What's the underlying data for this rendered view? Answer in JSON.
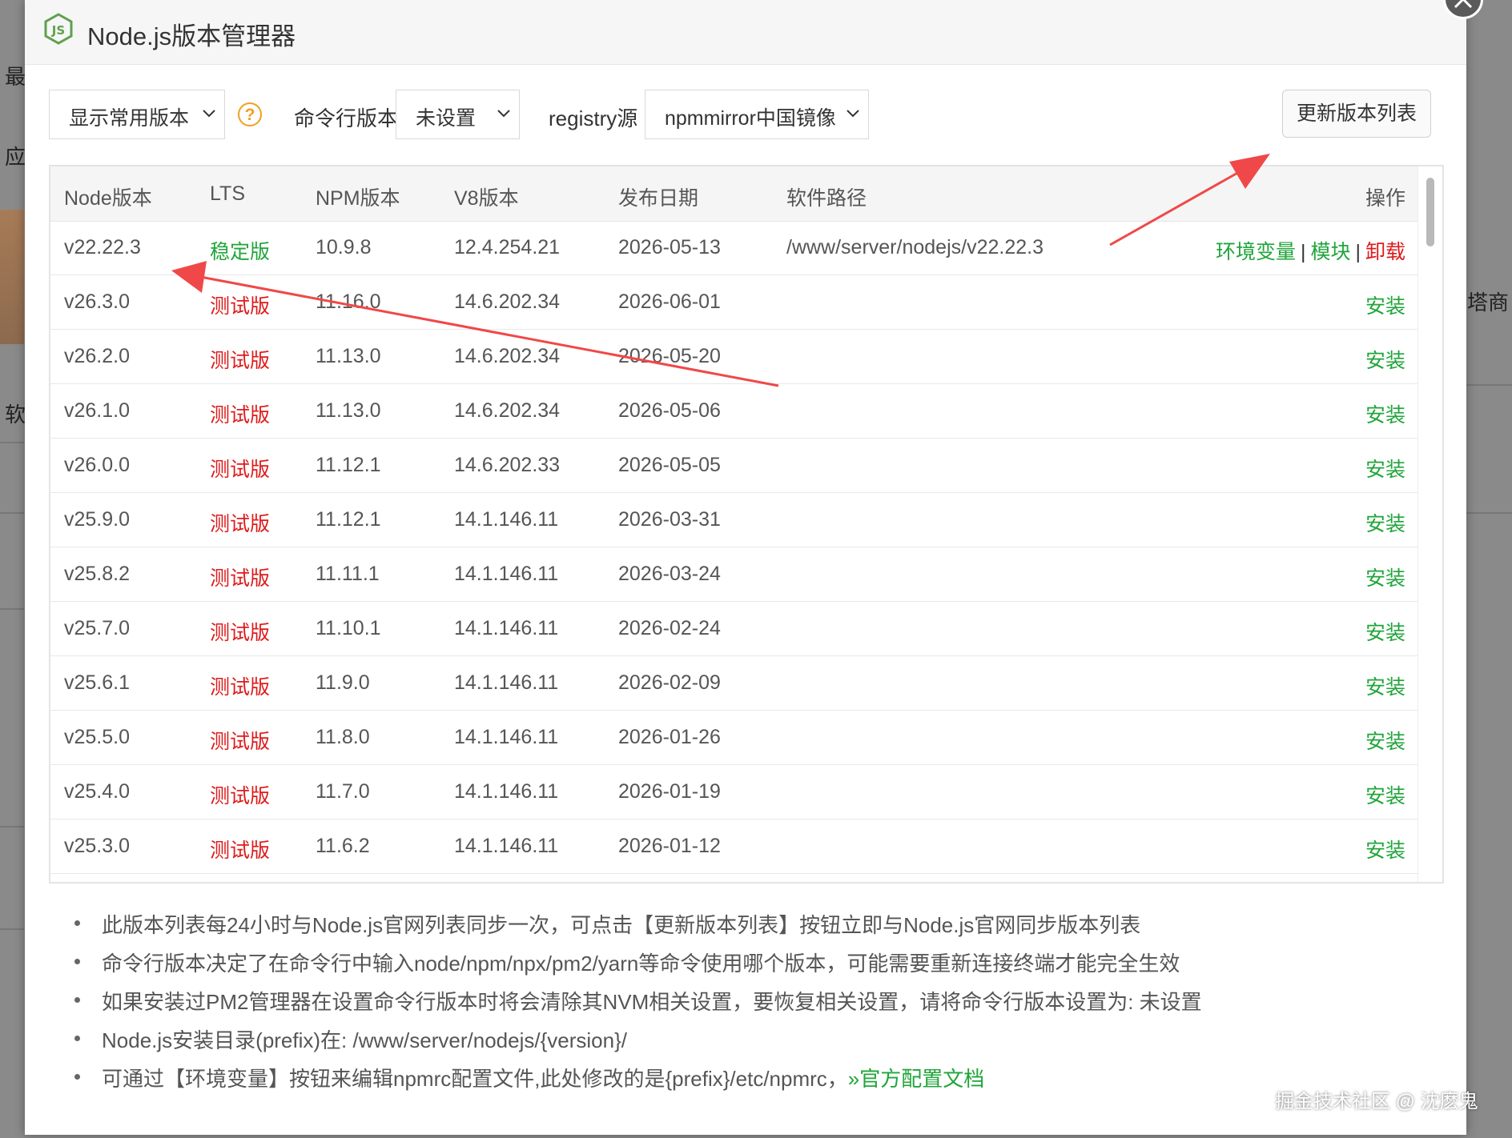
{
  "background": {
    "left_chars": [
      "最",
      "应",
      "软"
    ],
    "right_text": "塔商"
  },
  "dialog": {
    "title": "Node.js版本管理器",
    "logo_icon": "nodejs-icon",
    "close_icon": "close-icon"
  },
  "toolbar": {
    "version_filter": "显示常用版本",
    "help_icon": "?",
    "cli_label": "命令行版本",
    "cli_value": "未设置",
    "registry_label": "registry源",
    "registry_value": "npmmirror中国镜像",
    "update_button": "更新版本列表"
  },
  "table": {
    "headers": {
      "node": "Node版本",
      "lts": "LTS",
      "npm": "NPM版本",
      "v8": "V8版本",
      "date": "发布日期",
      "path": "软件路径",
      "action": "操作"
    },
    "rows": [
      {
        "node": "v22.22.3",
        "lts": "稳定版",
        "npm": "10.9.8",
        "v8": "12.4.254.21",
        "date": "2026-05-13",
        "path": "/www/server/nodejs/v22.22.3",
        "env": "环境变量",
        "modules": "模块",
        "uninstall": "卸载",
        "sep": "|"
      },
      {
        "node": "v26.3.0",
        "lts": "测试版",
        "npm": "11.16.0",
        "v8": "14.6.202.34",
        "date": "2026-06-01",
        "install": "安装"
      },
      {
        "node": "v26.2.0",
        "lts": "测试版",
        "npm": "11.13.0",
        "v8": "14.6.202.34",
        "date": "2026-05-20",
        "install": "安装"
      },
      {
        "node": "v26.1.0",
        "lts": "测试版",
        "npm": "11.13.0",
        "v8": "14.6.202.34",
        "date": "2026-05-06",
        "install": "安装"
      },
      {
        "node": "v26.0.0",
        "lts": "测试版",
        "npm": "11.12.1",
        "v8": "14.6.202.33",
        "date": "2026-05-05",
        "install": "安装"
      },
      {
        "node": "v25.9.0",
        "lts": "测试版",
        "npm": "11.12.1",
        "v8": "14.1.146.11",
        "date": "2026-03-31",
        "install": "安装"
      },
      {
        "node": "v25.8.2",
        "lts": "测试版",
        "npm": "11.11.1",
        "v8": "14.1.146.11",
        "date": "2026-03-24",
        "install": "安装"
      },
      {
        "node": "v25.7.0",
        "lts": "测试版",
        "npm": "11.10.1",
        "v8": "14.1.146.11",
        "date": "2026-02-24",
        "install": "安装"
      },
      {
        "node": "v25.6.1",
        "lts": "测试版",
        "npm": "11.9.0",
        "v8": "14.1.146.11",
        "date": "2026-02-09",
        "install": "安装"
      },
      {
        "node": "v25.5.0",
        "lts": "测试版",
        "npm": "11.8.0",
        "v8": "14.1.146.11",
        "date": "2026-01-26",
        "install": "安装"
      },
      {
        "node": "v25.4.0",
        "lts": "测试版",
        "npm": "11.7.0",
        "v8": "14.1.146.11",
        "date": "2026-01-19",
        "install": "安装"
      },
      {
        "node": "v25.3.0",
        "lts": "测试版",
        "npm": "11.6.2",
        "v8": "14.1.146.11",
        "date": "2026-01-12",
        "install": "安装"
      }
    ]
  },
  "notes": [
    "此版本列表每24小时与Node.js官网列表同步一次，可点击【更新版本列表】按钮立即与Node.js官网同步版本列表",
    "命令行版本决定了在命令行中输入node/npm/npx/pm2/yarn等命令使用哪个版本，可能需要重新连接终端才能完全生效",
    "如果安装过PM2管理器在设置命令行版本时将会清除其NVM相关设置，要恢复相关设置，请将命令行版本设置为: 未设置",
    "Node.js安装目录(prefix)在: /www/server/nodejs/{version}/",
    "可通过【环境变量】按钮来编辑npmrc配置文件,此处修改的是{prefix}/etc/npmrc，"
  ],
  "doc_link": "»官方配置文档",
  "watermark": "掘金技术社区 @ 沈麽鬼",
  "colors": {
    "green": "#20a53a",
    "red": "#dd1b1b",
    "annotation_arrow": "#f04848"
  }
}
